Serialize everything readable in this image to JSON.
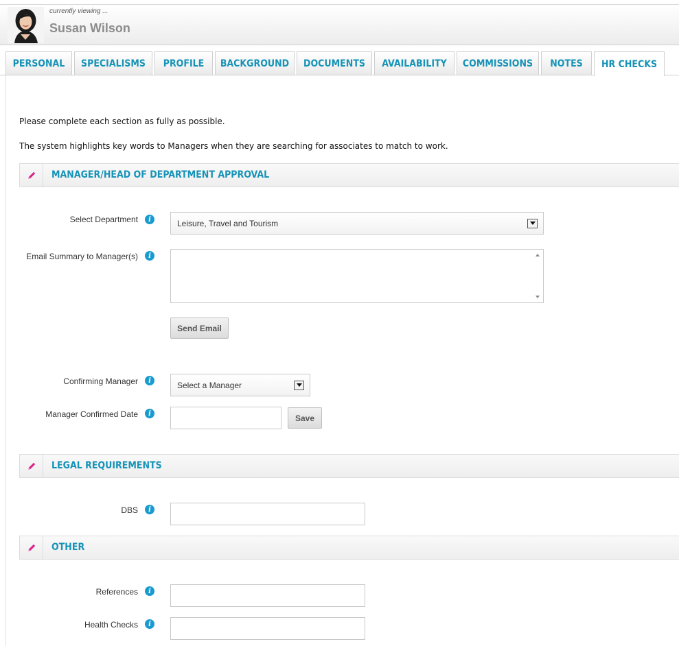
{
  "header": {
    "currently_viewing": "currently viewing ...",
    "user_name": "Susan Wilson",
    "avatar_icon": "person-photo-avatar"
  },
  "tabs": [
    {
      "label": "PERSONAL",
      "active": false
    },
    {
      "label": "SPECIALISMS",
      "active": false
    },
    {
      "label": "PROFILE",
      "active": false
    },
    {
      "label": "BACKGROUND",
      "active": false
    },
    {
      "label": "DOCUMENTS",
      "active": false
    },
    {
      "label": "AVAILABILITY",
      "active": false
    },
    {
      "label": "COMMISSIONS",
      "active": false
    },
    {
      "label": "NOTES",
      "active": false
    },
    {
      "label": "HR CHECKS",
      "active": true
    }
  ],
  "intro": {
    "line1": "Please complete each section as fully as possible.",
    "line2": "The system highlights key words to Managers when they are searching for associates to match to work."
  },
  "sections": {
    "approval": {
      "title": "MANAGER/HEAD OF DEPARTMENT APPROVAL",
      "select_department_label": "Select Department",
      "select_department_value": "Leisure, Travel and Tourism",
      "email_summary_label": "Email Summary to Manager(s)",
      "email_summary_value": "",
      "send_email_label": "Send Email",
      "confirming_manager_label": "Confirming Manager",
      "confirming_manager_value": "Select a Manager",
      "confirmed_date_label": "Manager Confirmed Date",
      "confirmed_date_value": "",
      "save_label": "Save"
    },
    "legal": {
      "title": "LEGAL REQUIREMENTS",
      "dbs_label": "DBS",
      "dbs_value": ""
    },
    "other": {
      "title": "OTHER",
      "references_label": "References",
      "references_value": "",
      "health_checks_label": "Health Checks",
      "health_checks_value": ""
    }
  },
  "info_icon_glyph": "i",
  "colors": {
    "accent": "#1693b7",
    "info": "#1a9bd0",
    "pen": "#d9268a"
  }
}
